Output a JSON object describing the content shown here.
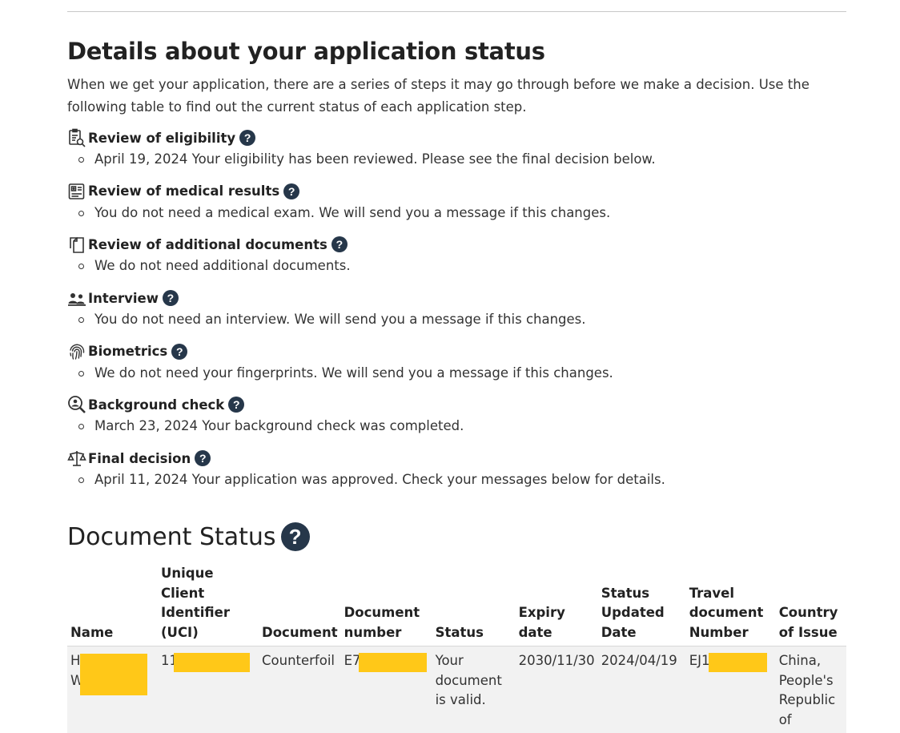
{
  "status": {
    "title": "Details about your application status",
    "intro": "When we get your application, there are a series of steps it may go through before we make a decision. Use the following table to find out the current status of each application step.",
    "steps": [
      {
        "icon": "clipboard-search-icon",
        "title": "Review of eligibility",
        "detail": "April 19, 2024 Your eligibility has been reviewed. Please see the final decision below."
      },
      {
        "icon": "medical-clipboard-icon",
        "title": "Review of medical results",
        "detail": "You do not need a medical exam. We will send you a message if this changes."
      },
      {
        "icon": "documents-icon",
        "title": "Review of additional documents",
        "detail": "We do not need additional documents."
      },
      {
        "icon": "people-icon",
        "title": "Interview",
        "detail": "You do not need an interview. We will send you a message if this changes."
      },
      {
        "icon": "fingerprint-icon",
        "title": "Biometrics",
        "detail": "We do not need your fingerprints. We will send you a message if this changes."
      },
      {
        "icon": "search-person-icon",
        "title": "Background check",
        "detail": "March 23, 2024 Your background check was completed."
      },
      {
        "icon": "scales-icon",
        "title": "Final decision",
        "detail": "April 11, 2024 Your application was approved. Check your messages below for details."
      }
    ],
    "help_glyph": "?"
  },
  "documents": {
    "title": "Document Status",
    "columns": {
      "name": "Name",
      "uci": "Unique Client Identifier (UCI)",
      "document": "Document",
      "doc_number": "Document number",
      "status": "Status",
      "expiry": "Expiry date",
      "updated": "Status Updated Date",
      "travel": "Travel document Number",
      "country": "Country of Issue"
    },
    "row": {
      "name_line1": "H",
      "name_line2": "W",
      "uci": "11",
      "document": "Counterfoil",
      "doc_number": "E7",
      "status": "Your document is valid.",
      "expiry": "2030/11/30",
      "updated": "2024/04/19",
      "travel": "EJ1",
      "country": "China, People's Republic of"
    },
    "redaction_color": "#ffc818"
  },
  "colors": {
    "help_icon": "#26374a",
    "row_background": "#f2f2f2"
  }
}
